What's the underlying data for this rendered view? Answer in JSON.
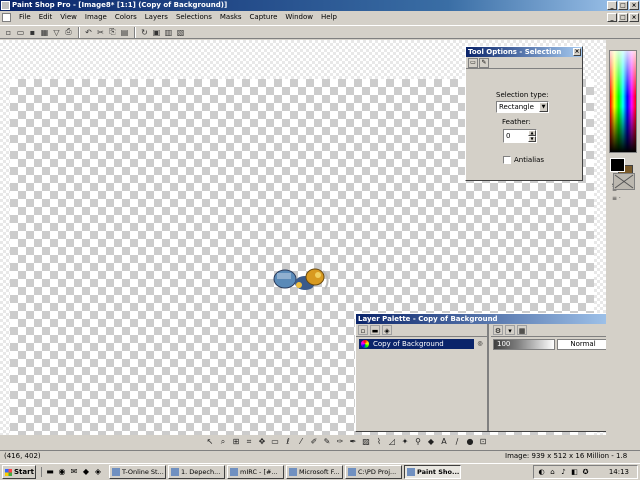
{
  "window": {
    "title": "Paint Shop Pro - [Image8* [1:1] (Copy of Background)]",
    "min": "_",
    "max": "□",
    "close": "×"
  },
  "menu": [
    "File",
    "Edit",
    "View",
    "Image",
    "Colors",
    "Layers",
    "Selections",
    "Masks",
    "Capture",
    "Window",
    "Help"
  ],
  "toolbar_icons": [
    "new-icon",
    "open-icon",
    "save-icon",
    "print-icon",
    "undo-icon",
    "cut-icon",
    "copy-icon",
    "paste-icon",
    "browse-icon"
  ],
  "tool_options": {
    "title": "Tool Options - Selection",
    "selection_type_label": "Selection type:",
    "selection_type_value": "Rectangle",
    "feather_label": "Feather:",
    "feather_value": "0",
    "antialias_label": "Antialias",
    "antialias_checked": false
  },
  "layer_palette": {
    "title": "Layer Palette - Copy of Background",
    "layer_name": "Copy of Background",
    "opacity": "100",
    "blend_mode": "Normal"
  },
  "colors": {
    "foreground": "#000000",
    "background": "#7a5a2a",
    "accent": "#0a246a"
  },
  "status": {
    "coords": "(416, 402)",
    "image_info": "Image:  939 x 512 x 16 Million - 1.8 MBytes"
  },
  "taskbar": {
    "start": "Start",
    "tasks": [
      "T-Online St...",
      "1. Depech...",
      "mIRC - [#...",
      "Microsoft F...",
      "C:\\PD Proj...",
      "Paint Sho..."
    ],
    "clock": "14:13"
  }
}
